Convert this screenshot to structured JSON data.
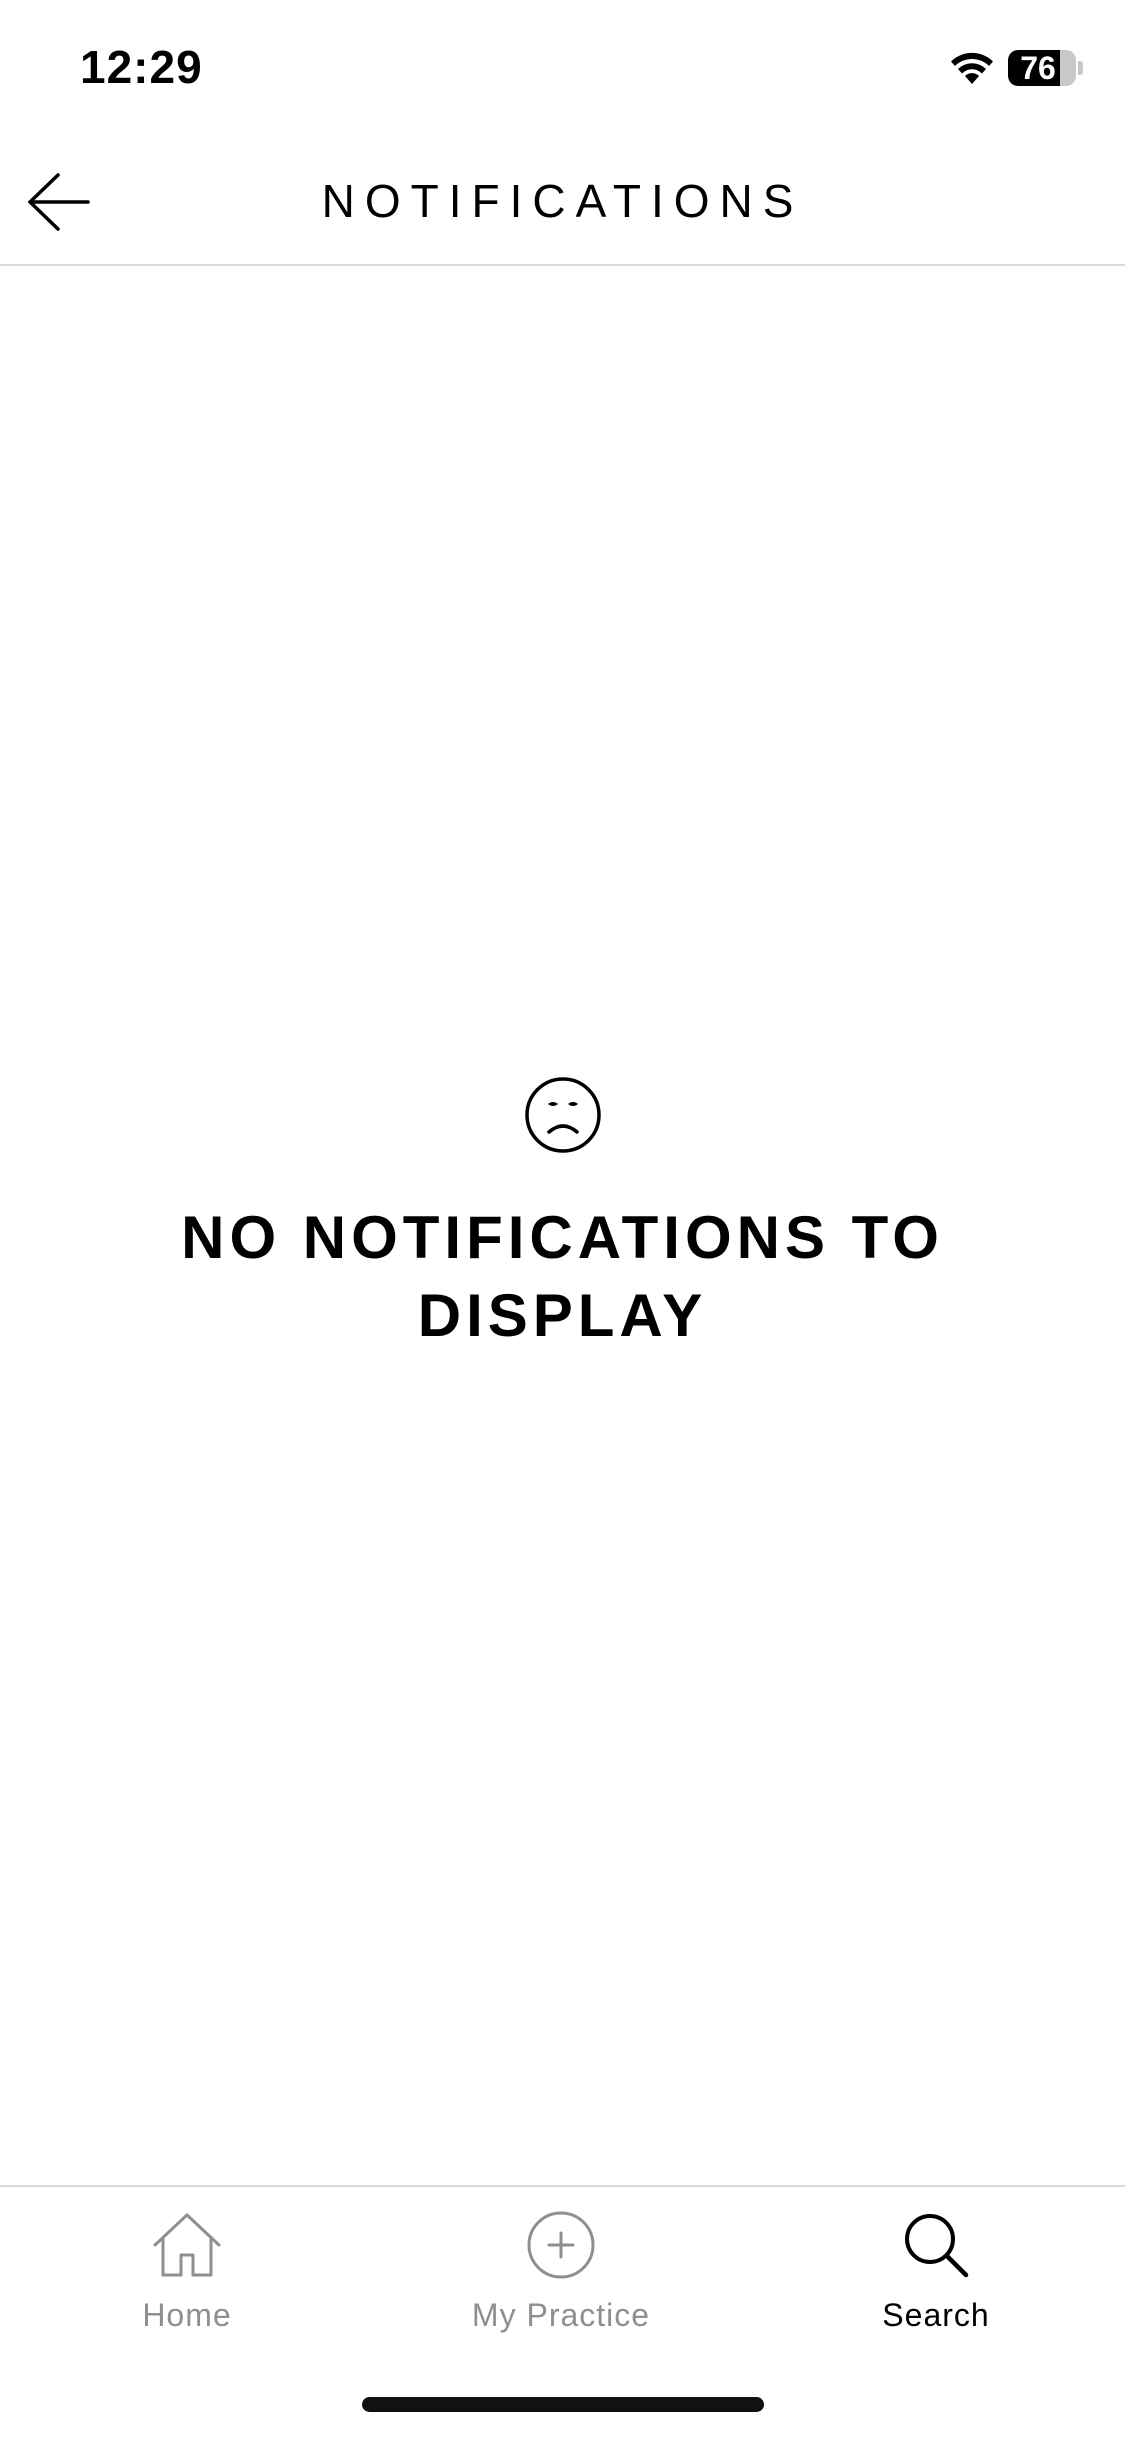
{
  "status_bar": {
    "time": "12:29",
    "battery_level": "76",
    "battery_fraction": 0.76
  },
  "header": {
    "title": "NOTIFICATIONS",
    "back_icon": "arrow-left-icon"
  },
  "empty_state": {
    "icon": "sad-face-icon",
    "message": "NO NOTIFICATIONS TO DISPLAY"
  },
  "tab_bar": {
    "tabs": [
      {
        "label": "Home",
        "icon": "home-icon",
        "active": false
      },
      {
        "label": "My Practice",
        "icon": "plus-circle-icon",
        "active": false
      },
      {
        "label": "Search",
        "icon": "search-icon",
        "active": true
      }
    ]
  },
  "colors": {
    "background": "#ffffff",
    "text": "#000000",
    "inactive_tab": "#8f8f8f",
    "divider": "#d9d9d9"
  }
}
